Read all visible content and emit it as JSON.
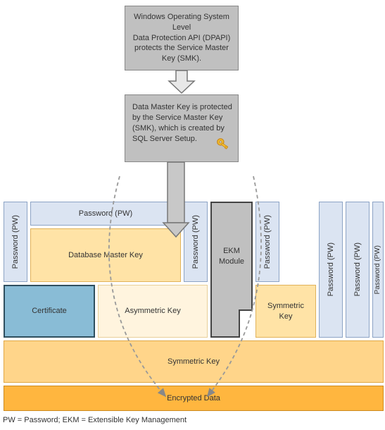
{
  "top_box": {
    "text": "Windows Operating System Level\nData Protection API (DPAPI) protects the Service Master Key (SMK)."
  },
  "dmk_box": {
    "text": "Data Master Key is protected by the Service Master Key (SMK), which is created by\nSQL Server Setup."
  },
  "labels": {
    "password_pw": "Password (PW)",
    "database_master_key": "Database Master Key",
    "certificate": "Certificate",
    "asymmetric_key": "Asymmetric Key",
    "ekm_module": "EKM Module",
    "symmetric_key_small": "Symmetric Key",
    "symmetric_key_wide": "Symmetric Key",
    "encrypted_data": "Encrypted Data"
  },
  "legend": "PW = Password; EKM = Extensible Key Management",
  "colors": {
    "gray": "#c0c0c0",
    "blue_light": "#dbe4f2",
    "orange_light": "#ffe3a6",
    "orange_pale": "#fff4de",
    "orange_mid": "#ffd58a",
    "orange_deep": "#ffb63f",
    "cert_blue": "#89bcd6"
  }
}
